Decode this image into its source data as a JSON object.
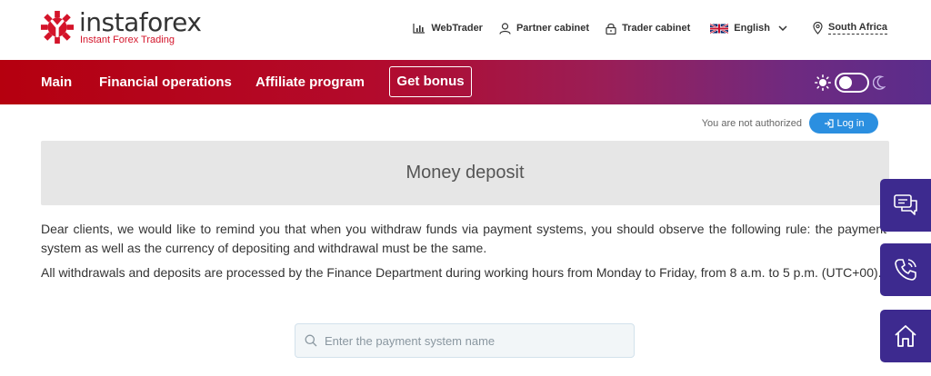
{
  "brand": {
    "name": "instaforex",
    "tagline": "Instant Forex Trading",
    "color": "#d4142a"
  },
  "topnav": {
    "webtrader": "WebTrader",
    "partner_cabinet": "Partner cabinet",
    "trader_cabinet": "Trader cabinet",
    "language": "English",
    "region": "South Africa"
  },
  "mainnav": {
    "items": [
      "Main",
      "Financial operations",
      "Affiliate program"
    ],
    "bonus": "Get bonus",
    "gradient_start": "#b5000f",
    "gradient_end": "#5a2d8c"
  },
  "auth": {
    "message": "You are not authorized",
    "login_label": "Log in",
    "login_color": "#2b8fe0"
  },
  "page": {
    "title": "Money deposit",
    "paragraph1": "Dear clients, we would like to remind you that when you withdraw funds via payment systems, you should observe the following rule: the payment system as well as the currency of depositing and withdrawal must be the same.",
    "paragraph2": "All withdrawals and deposits are processed by the Finance Department during working hours from Monday to Friday, from 8 a.m. to 5 p.m. (UTC+00)."
  },
  "search": {
    "placeholder": "Enter the payment system name",
    "value": ""
  },
  "side_buttons": {
    "icons": [
      "chat-icon",
      "phone-icon",
      "home-icon"
    ],
    "color": "#3d2a8f"
  }
}
